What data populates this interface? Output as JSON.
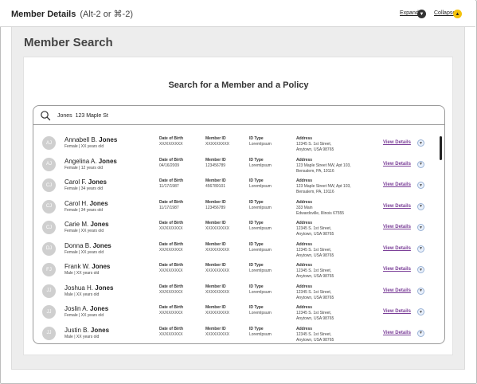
{
  "header": {
    "title": "Member Details",
    "shortcut_hint": "(Alt-2 or ⌘-2)",
    "expand_label": "Expand",
    "collapse_label": "Collapse",
    "expand_icon": "chevron-down-icon",
    "collapse_icon": "chevron-up-icon"
  },
  "panel": {
    "title": "Member Search",
    "search_heading": "Search for a Member and a Policy"
  },
  "search": {
    "value": "Jones  123 Maple St"
  },
  "colors": {
    "link": "#7b3f98",
    "collapse_accent": "#f4c20d",
    "avatar_bg": "#cfcfcf"
  },
  "columns": {
    "dob": "Date of Birth",
    "member_id": "Member ID",
    "id_type": "ID Type",
    "address": "Address"
  },
  "view_label": "View Details",
  "members": [
    {
      "initials": "AJ",
      "first": "Annabell B.",
      "last": "Jones",
      "sub": "Female | XX years old",
      "dob": "XX/XX/XXXX",
      "member_id": "XXXXXXXXX",
      "id_type": "LoremIpsum",
      "addr1": "12345 S. 1st Street,",
      "addr2": "Anytown, USA 98765"
    },
    {
      "initials": "AJ",
      "first": "Angelina A.",
      "last": "Jones",
      "sub": "Female | 12 years old",
      "dob": "04/16/2009",
      "member_id": "123456789",
      "id_type": "LoremIpsum",
      "addr1": "123 Maple Street NW, Apt 103,",
      "addr2": "Bensalem, PA, 19116"
    },
    {
      "initials": "CJ",
      "first": "Carol F.",
      "last": "Jones",
      "sub": "Female | 34 years old",
      "dob": "11/17/1987",
      "member_id": "456789101",
      "id_type": "LoremIpsum",
      "addr1": "123 Maple Street NW, Apt 103,",
      "addr2": "Bensalem, PA, 19116"
    },
    {
      "initials": "CJ",
      "first": "Carol H.",
      "last": "Jones",
      "sub": "Female | 34 years old",
      "dob": "11/17/1987",
      "member_id": "123456789",
      "id_type": "LoremIpsum",
      "addr1": "333 Main",
      "addr2": "Edwardsville, Illinois  67555"
    },
    {
      "initials": "CJ",
      "first": "Carie M.",
      "last": "Jones",
      "sub": "Female | XX years old",
      "dob": "XX/XX/XXXX",
      "member_id": "XXXXXXXXX",
      "id_type": "LoremIpsum",
      "addr1": "12345 S. 1st Street,",
      "addr2": "Anytown, USA 98765"
    },
    {
      "initials": "DJ",
      "first": "Donna  B.",
      "last": "Jones",
      "sub": "Female | XX years old",
      "dob": "XX/XX/XXXX",
      "member_id": "XXXXXXXXX",
      "id_type": "LoremIpsum",
      "addr1": "12345 S. 1st Street,",
      "addr2": "Anytown, USA 98765"
    },
    {
      "initials": "FJ",
      "first": "Frank W.",
      "last": "Jones",
      "sub": "Male | XX years old",
      "dob": "XX/XX/XXXX",
      "member_id": "XXXXXXXXX",
      "id_type": "LoremIpsum",
      "addr1": "12345 S. 1st Street,",
      "addr2": "Anytown, USA 98765"
    },
    {
      "initials": "JJ",
      "first": "Joshua H.",
      "last": "Jones",
      "sub": "Male | XX years old",
      "dob": "XX/XX/XXXX",
      "member_id": "XXXXXXXXX",
      "id_type": "LoremIpsum",
      "addr1": "12345 S. 1st Street,",
      "addr2": "Anytown, USA 98765"
    },
    {
      "initials": "JJ",
      "first": "Joslin A.",
      "last": "Jones",
      "sub": "Female | XX years old",
      "dob": "XX/XX/XXXX",
      "member_id": "XXXXXXXXX",
      "id_type": "LoremIpsum",
      "addr1": "12345 S. 1st Street,",
      "addr2": "Anytown, USA 98765"
    },
    {
      "initials": "JJ",
      "first": "Justin  B.",
      "last": "Jones",
      "sub": "Male | XX years old",
      "dob": "XX/XX/XXXX",
      "member_id": "XXXXXXXXX",
      "id_type": "LoremIpsum",
      "addr1": "12345 S. 1st Street,",
      "addr2": "Anytown, USA 98765"
    }
  ]
}
